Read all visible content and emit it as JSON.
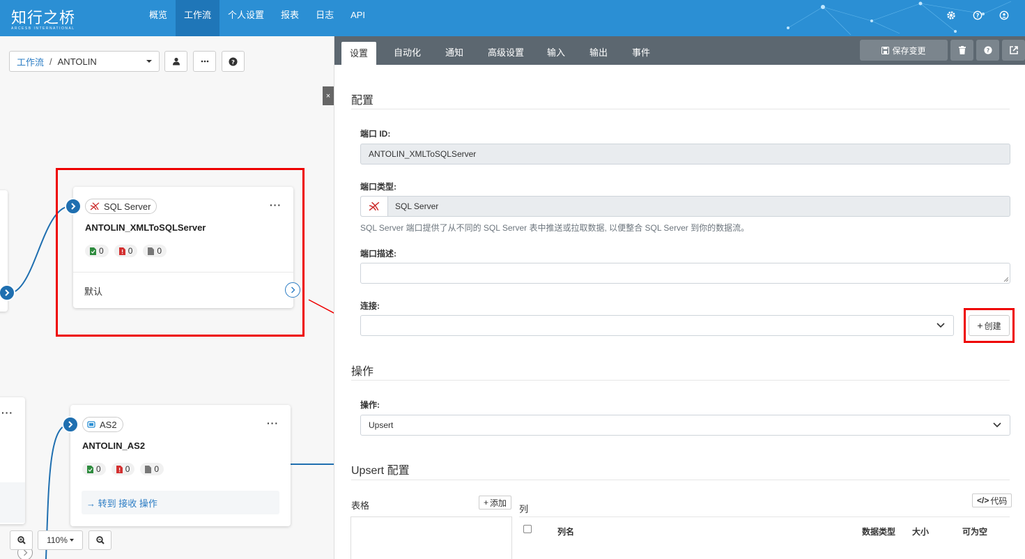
{
  "app": {
    "logo_main": "知行之桥",
    "logo_sub": "ARCESB INTERNATIONAL"
  },
  "nav": {
    "items": [
      "概览",
      "工作流",
      "个人设置",
      "报表",
      "日志",
      "API"
    ],
    "active_index": 1
  },
  "top_icons": [
    "gear-icon",
    "help-icon",
    "user-icon"
  ],
  "canvas": {
    "breadcrumb": {
      "link": "工作流",
      "separator": "/",
      "current": "ANTOLIN"
    },
    "close_label": "×",
    "card1": {
      "type": "SQL Server",
      "name": "ANTOLIN_XMLToSQLServer",
      "stats": [
        "0",
        "0",
        "0"
      ],
      "footer": "默认"
    },
    "card2": {
      "type": "AS2",
      "name": "ANTOLIN_AS2",
      "stats": [
        "0",
        "0",
        "0"
      ],
      "footer_link": "→ 转到 接收 操作"
    },
    "zoom": "110%"
  },
  "panel": {
    "tabs": [
      "设置",
      "自动化",
      "通知",
      "高级设置",
      "输入",
      "输出",
      "事件"
    ],
    "active_tab": 0,
    "save_label": "保存变更",
    "config": {
      "title": "配置",
      "port_id_label": "端口 ID:",
      "port_id_value": "ANTOLIN_XMLToSQLServer",
      "port_type_label": "端口类型:",
      "port_type_value": "SQL Server",
      "port_type_help": "SQL Server 端口提供了从不同的 SQL Server 表中推送或拉取数据, 以便整合 SQL Server 到你的数据流。",
      "desc_label": "端口描述:",
      "desc_value": "",
      "connection_label": "连接:",
      "connection_value": "",
      "create_label": "创建"
    },
    "operation": {
      "title": "操作",
      "label": "操作:",
      "value": "Upsert"
    },
    "upsert": {
      "title": "Upsert 配置",
      "tables_label": "表格",
      "add_label": "添加",
      "columns_label": "列",
      "code_label": "代码",
      "headers": [
        "列名",
        "数据类型",
        "大小",
        "可为空"
      ]
    }
  },
  "colors": {
    "nav_bg": "#2b8fd4",
    "nav_active": "#1f76b8",
    "tabbar_bg": "#5c6770",
    "highlight_red": "#e00000"
  }
}
